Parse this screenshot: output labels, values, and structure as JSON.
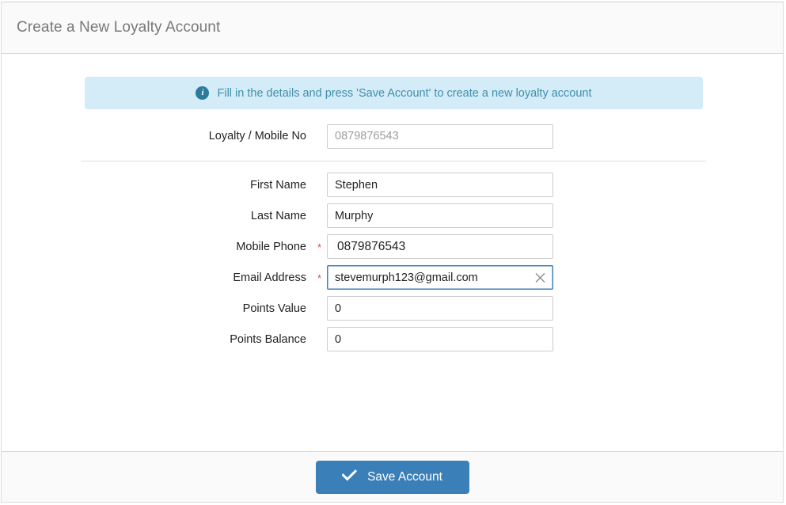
{
  "header": {
    "title": "Create a New Loyalty Account"
  },
  "alert": {
    "icon": "info-circle-icon",
    "text": "Fill in the details and press 'Save Account' to create a new loyalty account",
    "background_color": "#d4ecf7",
    "text_color": "#3f8fab"
  },
  "form": {
    "lookup": {
      "label": "Loyalty / Mobile No",
      "value": "",
      "placeholder": "0879876543"
    },
    "fields": [
      {
        "label": "First Name",
        "value": "Stephen",
        "required": false,
        "required_mark": "",
        "focused": false,
        "clearable": false
      },
      {
        "label": "Last Name",
        "value": "Murphy",
        "required": false,
        "required_mark": "",
        "focused": false,
        "clearable": false
      },
      {
        "label": "Mobile Phone",
        "value": "0879876543",
        "required": true,
        "required_mark": "*",
        "focused": false,
        "clearable": false
      },
      {
        "label": "Email Address",
        "value": "stevemurph123@gmail.com",
        "required": true,
        "required_mark": "*",
        "focused": true,
        "clearable": true,
        "clear_icon": "close-icon"
      },
      {
        "label": "Points Value",
        "value": "0",
        "required": false,
        "required_mark": "",
        "focused": false,
        "clearable": false
      },
      {
        "label": "Points Balance",
        "value": "0",
        "required": false,
        "required_mark": "",
        "focused": false,
        "clearable": false
      }
    ]
  },
  "footer": {
    "save_label": "Save Account",
    "save_icon": "check-icon",
    "save_color": "#3b7fb8"
  }
}
